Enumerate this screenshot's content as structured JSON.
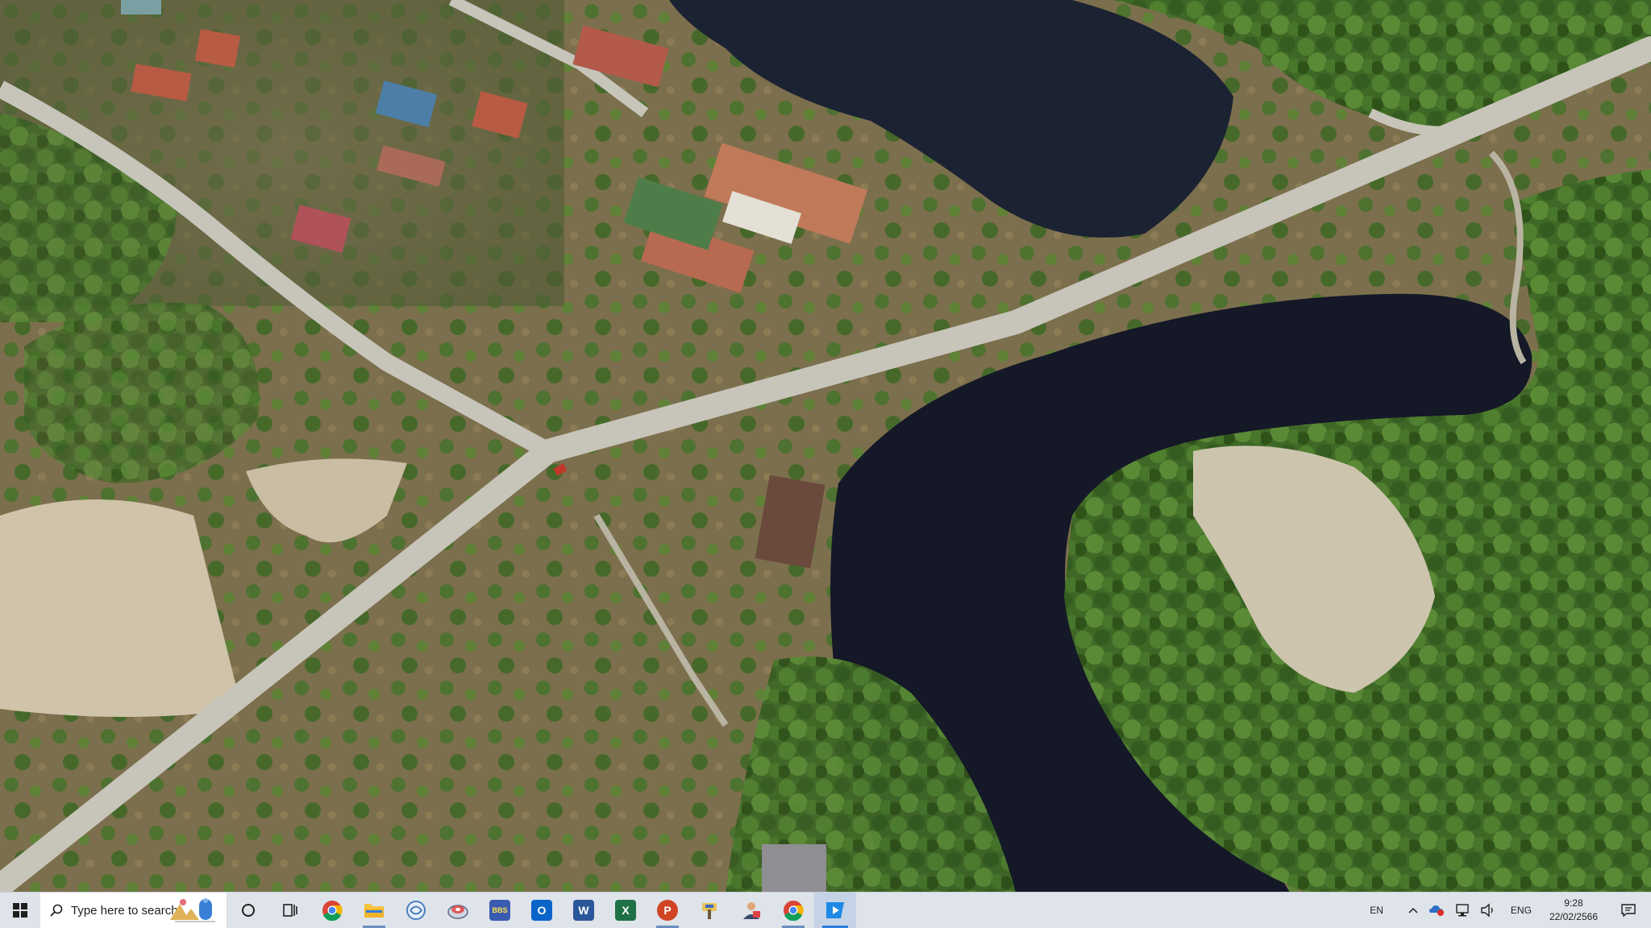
{
  "wallpaper": {
    "description_icon": "aerial-landscape-photo",
    "colors": {
      "water": "#151a2b",
      "forest": "#3f6b27",
      "road": "#c9c7bb",
      "dry": "#8a7a58",
      "roof": "#b85a48"
    }
  },
  "taskbar": {
    "start_icon": "windows-logo-icon",
    "search_placeholder": "Type here to search",
    "pinned": [
      {
        "name": "cortana",
        "icon": "circle-icon"
      },
      {
        "name": "task-view",
        "icon": "task-view-icon"
      },
      {
        "name": "chrome",
        "icon": "chrome-icon"
      },
      {
        "name": "file-explorer",
        "icon": "folder-icon"
      },
      {
        "name": "app-swirl",
        "icon": "swirl-app-icon"
      },
      {
        "name": "app-disk",
        "icon": "disk-app-icon"
      },
      {
        "name": "app-bbs",
        "icon": "bbs-app-icon",
        "label": "BBS"
      },
      {
        "name": "outlook",
        "icon": "outlook-icon",
        "label": "O"
      },
      {
        "name": "word",
        "icon": "word-icon",
        "label": "W"
      },
      {
        "name": "excel",
        "icon": "excel-icon",
        "label": "X"
      },
      {
        "name": "powerpoint",
        "icon": "powerpoint-icon",
        "label": "P"
      },
      {
        "name": "app-tools",
        "icon": "tools-app-icon"
      },
      {
        "name": "app-person",
        "icon": "person-app-icon"
      },
      {
        "name": "chrome-2",
        "icon": "chrome-icon"
      },
      {
        "name": "media-player",
        "icon": "media-player-icon"
      }
    ],
    "tray": {
      "input_lang": "EN",
      "keyboard_lang": "ENG",
      "time": "9:28",
      "date": "22/02/2566"
    }
  }
}
